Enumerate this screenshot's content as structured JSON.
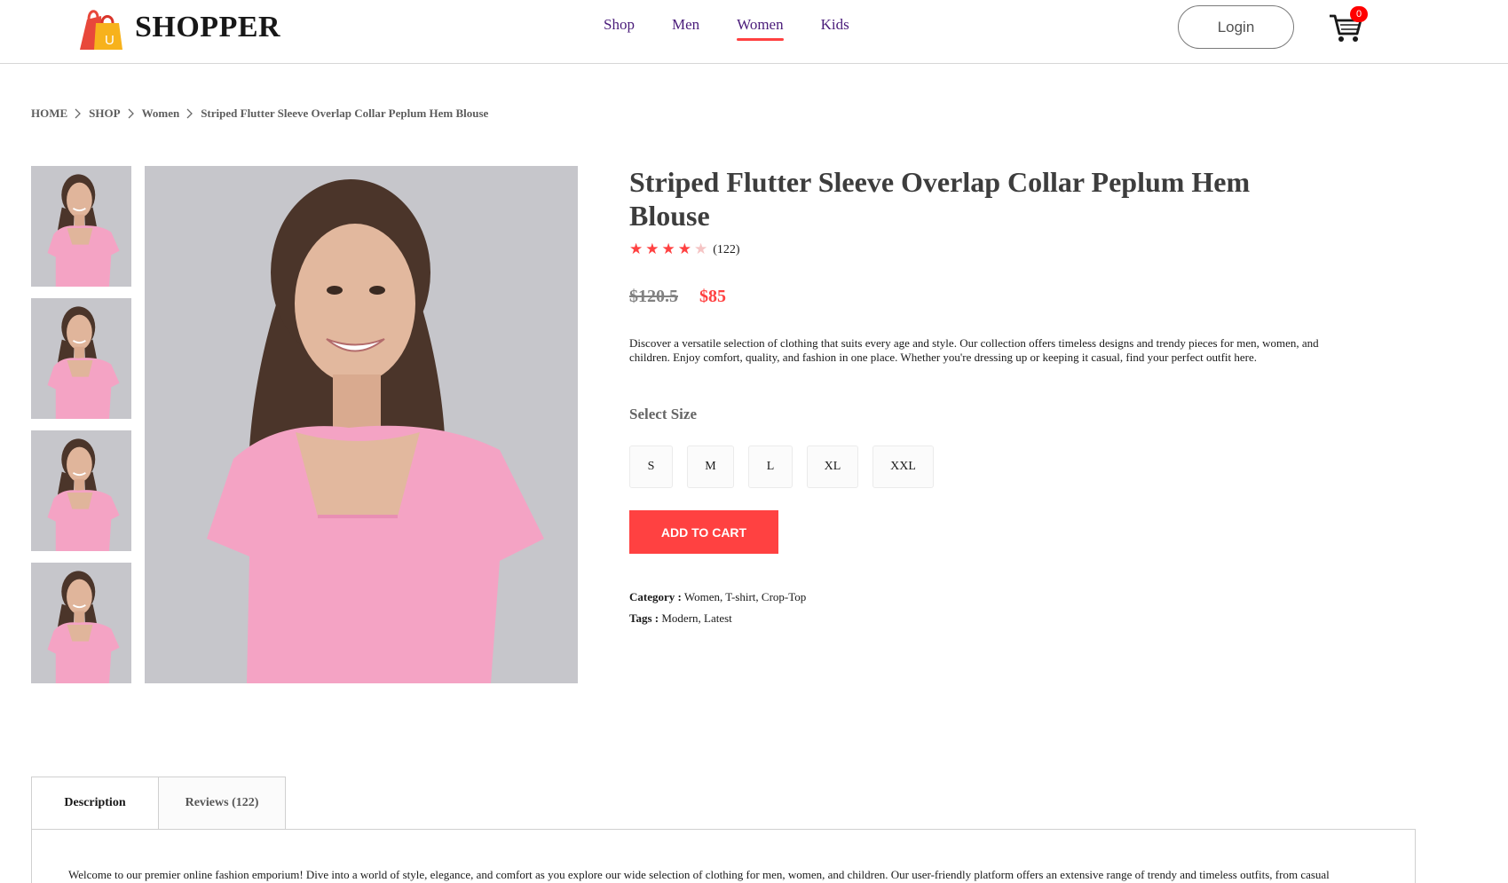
{
  "brand": {
    "name": "SHOPPER",
    "logo_letter": "U"
  },
  "nav": {
    "items": [
      {
        "label": "Shop",
        "active": false
      },
      {
        "label": "Men",
        "active": false
      },
      {
        "label": "Women",
        "active": true
      },
      {
        "label": "Kids",
        "active": false
      }
    ],
    "login_label": "Login",
    "cart_count": "0"
  },
  "breadcrumb": [
    "HOME",
    "SHOP",
    "Women",
    "Striped Flutter Sleeve Overlap Collar Peplum Hem Blouse"
  ],
  "product": {
    "title": "Striped Flutter Sleeve Overlap Collar Peplum Hem Blouse",
    "rating_stars": 4,
    "rating_max": 5,
    "review_count": "(122)",
    "old_price": "$120.5",
    "new_price": "$85",
    "description": "Discover a versatile selection of clothing that suits every age and style. Our collection offers timeless designs and trendy pieces for men, women, and children. Enjoy comfort, quality, and fashion in one place. Whether you're dressing up or keeping it casual, find your perfect outfit here.",
    "select_size_label": "Select Size",
    "sizes": [
      "S",
      "M",
      "L",
      "XL",
      "XXL"
    ],
    "add_to_cart_label": "ADD TO CART",
    "category_label": "Category :",
    "category_value": "Women, T-shirt, Crop-Top",
    "tags_label": "Tags :",
    "tags_value": "Modern, Latest"
  },
  "tabs": [
    {
      "label": "Description",
      "active": true
    },
    {
      "label": "Reviews (122)",
      "active": false
    }
  ],
  "tab_content": "Welcome to our premier online fashion emporium! Dive into a world of style, elegance, and comfort as you explore our wide selection of clothing for men, women, and children. Our user-friendly platform offers an extensive range of trendy and timeless outfits, from casual",
  "colors": {
    "accent": "#ff4141",
    "nav_text": "#4a1c7a",
    "shirt": "#f4a3c4",
    "photo_bg": "#c6c6cb"
  }
}
